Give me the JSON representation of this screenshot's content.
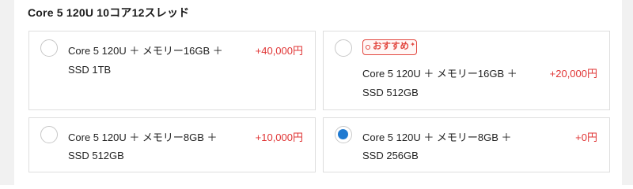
{
  "section": {
    "title": "Core 5 120U 10コア12スレッド"
  },
  "options": [
    {
      "line1": "Core 5 120U ＋ メモリー16GB ＋",
      "line2": "SSD 1TB",
      "price": "+40,000円",
      "selected": false,
      "recommended": false
    },
    {
      "line1": "Core 5 120U ＋ メモリー16GB ＋",
      "line2": "SSD 512GB",
      "price": "+20,000円",
      "selected": false,
      "recommended": true,
      "badge_label": "おすすめ"
    },
    {
      "line1": "Core 5 120U ＋ メモリー8GB ＋",
      "line2": "SSD 512GB",
      "price": "+10,000円",
      "selected": false,
      "recommended": false
    },
    {
      "line1": "Core 5 120U ＋ メモリー8GB ＋",
      "line2": "SSD 256GB",
      "price": "+0円",
      "selected": true,
      "recommended": false
    }
  ],
  "colors": {
    "price": "#e03434",
    "badge": "#e2473f",
    "radio_selected": "#1f7ad1",
    "border": "#dedede"
  },
  "icons": {
    "badge_spark": "sparkle-icon",
    "radio_checked": "radio-checked-icon",
    "radio_unchecked": "radio-unchecked-icon"
  }
}
